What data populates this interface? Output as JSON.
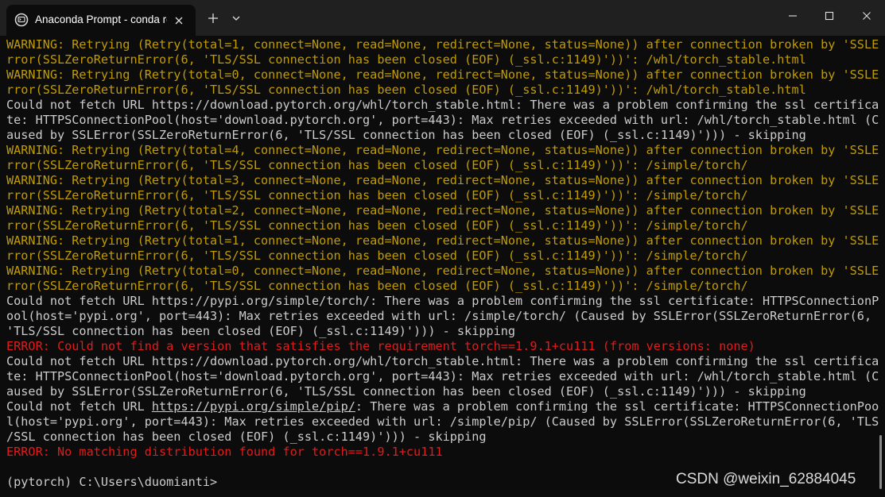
{
  "window": {
    "tab_title": "Anaconda Prompt - conda  re",
    "icons": {
      "tab": "terminal-icon",
      "close_tab": "close-icon",
      "new_tab": "plus-icon",
      "dropdown": "chevron-down-icon",
      "minimize": "minimize-icon",
      "maximize": "maximize-icon",
      "close": "close-icon"
    }
  },
  "colors": {
    "background": "#0c0c0c",
    "titlebar": "#202020",
    "text_normal": "#cccccc",
    "text_warning": "#c19c00",
    "text_error": "#e31b1b"
  },
  "terminal": {
    "lines": [
      {
        "style": "warning",
        "text": "WARNING: Retrying (Retry(total=1, connect=None, read=None, redirect=None, status=None)) after connection broken by 'SSLE"
      },
      {
        "style": "warning",
        "text": "rror(SSLZeroReturnError(6, 'TLS/SSL connection has been closed (EOF) (_ssl.c:1149)'))': /whl/torch_stable.html"
      },
      {
        "style": "warning",
        "text": "WARNING: Retrying (Retry(total=0, connect=None, read=None, redirect=None, status=None)) after connection broken by 'SSLE"
      },
      {
        "style": "warning",
        "text": "rror(SSLZeroReturnError(6, 'TLS/SSL connection has been closed (EOF) (_ssl.c:1149)'))': /whl/torch_stable.html"
      },
      {
        "style": "normal",
        "text": "Could not fetch URL https://download.pytorch.org/whl/torch_stable.html: There was a problem confirming the ssl certifica"
      },
      {
        "style": "normal",
        "text": "te: HTTPSConnectionPool(host='download.pytorch.org', port=443): Max retries exceeded with url: /whl/torch_stable.html (C"
      },
      {
        "style": "normal",
        "text": "aused by SSLError(SSLZeroReturnError(6, 'TLS/SSL connection has been closed (EOF) (_ssl.c:1149)'))) - skipping"
      },
      {
        "style": "warning",
        "text": "WARNING: Retrying (Retry(total=4, connect=None, read=None, redirect=None, status=None)) after connection broken by 'SSLE"
      },
      {
        "style": "warning",
        "text": "rror(SSLZeroReturnError(6, 'TLS/SSL connection has been closed (EOF) (_ssl.c:1149)'))': /simple/torch/"
      },
      {
        "style": "warning",
        "text": "WARNING: Retrying (Retry(total=3, connect=None, read=None, redirect=None, status=None)) after connection broken by 'SSLE"
      },
      {
        "style": "warning",
        "text": "rror(SSLZeroReturnError(6, 'TLS/SSL connection has been closed (EOF) (_ssl.c:1149)'))': /simple/torch/"
      },
      {
        "style": "warning",
        "text": "WARNING: Retrying (Retry(total=2, connect=None, read=None, redirect=None, status=None)) after connection broken by 'SSLE"
      },
      {
        "style": "warning",
        "text": "rror(SSLZeroReturnError(6, 'TLS/SSL connection has been closed (EOF) (_ssl.c:1149)'))': /simple/torch/"
      },
      {
        "style": "warning",
        "text": "WARNING: Retrying (Retry(total=1, connect=None, read=None, redirect=None, status=None)) after connection broken by 'SSLE"
      },
      {
        "style": "warning",
        "text": "rror(SSLZeroReturnError(6, 'TLS/SSL connection has been closed (EOF) (_ssl.c:1149)'))': /simple/torch/"
      },
      {
        "style": "warning",
        "text": "WARNING: Retrying (Retry(total=0, connect=None, read=None, redirect=None, status=None)) after connection broken by 'SSLE"
      },
      {
        "style": "warning",
        "text": "rror(SSLZeroReturnError(6, 'TLS/SSL connection has been closed (EOF) (_ssl.c:1149)'))': /simple/torch/"
      },
      {
        "style": "normal",
        "text": "Could not fetch URL https://pypi.org/simple/torch/: There was a problem confirming the ssl certificate: HTTPSConnectionP"
      },
      {
        "style": "normal",
        "text": "ool(host='pypi.org', port=443): Max retries exceeded with url: /simple/torch/ (Caused by SSLError(SSLZeroReturnError(6,"
      },
      {
        "style": "normal",
        "text": "'TLS/SSL connection has been closed (EOF) (_ssl.c:1149)'))) - skipping"
      },
      {
        "style": "error",
        "text": "ERROR: Could not find a version that satisfies the requirement torch==1.9.1+cu111 (from versions: none)"
      },
      {
        "style": "normal",
        "text": "Could not fetch URL https://download.pytorch.org/whl/torch_stable.html: There was a problem confirming the ssl certifica"
      },
      {
        "style": "normal",
        "text": "te: HTTPSConnectionPool(host='download.pytorch.org', port=443): Max retries exceeded with url: /whl/torch_stable.html (C"
      },
      {
        "style": "normal",
        "text": "aused by SSLError(SSLZeroReturnError(6, 'TLS/SSL connection has been closed (EOF) (_ssl.c:1149)'))) - skipping"
      },
      {
        "style": "normal",
        "pre": "Could not fetch URL ",
        "link": "https://pypi.org/simple/pip/",
        "post": ": There was a problem confirming the ssl certificate: HTTPSConnectionPoo"
      },
      {
        "style": "normal",
        "text": "l(host='pypi.org', port=443): Max retries exceeded with url: /simple/pip/ (Caused by SSLError(SSLZeroReturnError(6, 'TLS"
      },
      {
        "style": "normal",
        "text": "/SSL connection has been closed (EOF) (_ssl.c:1149)'))) - skipping"
      },
      {
        "style": "error",
        "text": "ERROR: No matching distribution found for torch==1.9.1+cu111"
      },
      {
        "style": "normal",
        "text": ""
      },
      {
        "style": "normal",
        "text": "(pytorch) C:\\Users\\duomianti>"
      }
    ]
  },
  "watermark": "CSDN @weixin_62884045"
}
